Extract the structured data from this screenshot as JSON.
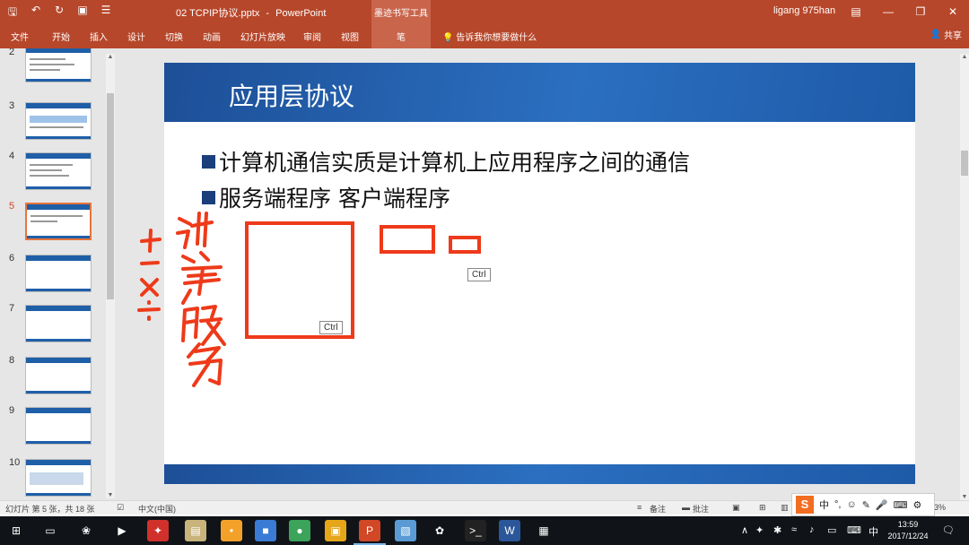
{
  "window": {
    "file_name": "02 TCPIP协议.pptx",
    "separator": "-",
    "app_name": "PowerPoint",
    "contextual_tab_group": "墨迹书写工具",
    "user": "ligang 975han"
  },
  "ribbon": {
    "tabs": [
      "文件",
      "开始",
      "插入",
      "设计",
      "切换",
      "动画",
      "幻灯片放映",
      "审阅",
      "视图"
    ],
    "contextual_tab": "笔",
    "tell_me": "告诉我你想要做什么",
    "share": "共享"
  },
  "thumbnails": {
    "numbers": [
      "2",
      "3",
      "4",
      "5",
      "6",
      "7",
      "8",
      "9",
      "10"
    ],
    "active": "5"
  },
  "slide": {
    "title": "应用层协议",
    "bullets": [
      "计算机通信实质是计算机上应用程序之间的通信",
      "服务端程序 客户端程序"
    ],
    "ink_color": "#ee3a1a",
    "ctrl_tags": [
      "Ctrl",
      "Ctrl"
    ]
  },
  "status": {
    "slide_info": "幻灯片 第 5 张，共 18 张",
    "language": "中文(中国)",
    "notes": "备注",
    "comments": "批注",
    "zoom": "83%"
  },
  "ime": {
    "logo": "S",
    "mode": "中"
  },
  "taskbar": {
    "tray_lang": "中",
    "time": "13:59",
    "date": "2017/12/24"
  },
  "colors": {
    "ppt_accent": "#b7472a",
    "slide_blue": "#1f5fa8",
    "active_thumb": "#e8743a"
  }
}
